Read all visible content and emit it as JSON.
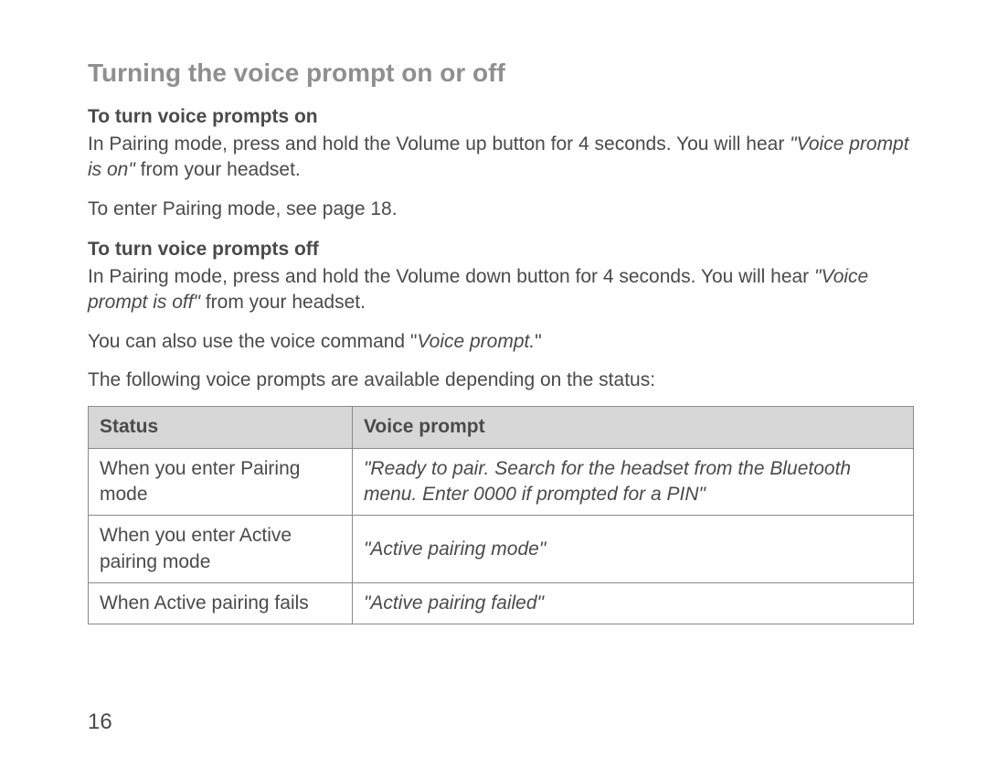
{
  "page_number": "16",
  "title": "Turning the voice prompt on or off",
  "on": {
    "heading": "To turn voice prompts on",
    "p1_pre": "In Pairing mode, press and hold the Volume up button for 4 seconds. You will hear ",
    "p1_quote": "\"Voice prompt is on\"",
    "p1_post": " from your headset.",
    "p2": "To enter Pairing mode, see page 18."
  },
  "off": {
    "heading": "To turn voice prompts off",
    "p1_pre": "In Pairing mode, press and hold the Volume down button for 4 seconds. You will hear ",
    "p1_quote": "\"Voice prompt is off\"",
    "p1_post": " from your headset.",
    "p2_pre": "You can also use the voice command \"",
    "p2_quote": "Voice prompt.",
    "p2_post": "\"",
    "p3": "The following voice prompts are available depending on the status:"
  },
  "table": {
    "headers": {
      "status": "Status",
      "prompt": "Voice prompt"
    },
    "rows": [
      {
        "status": "When you enter Pairing mode",
        "prompt": "\"Ready to pair. Search for the headset from the Bluetooth menu. Enter 0000 if prompted for a PIN\""
      },
      {
        "status": "When you enter Active pairing mode",
        "prompt": "\"Active pairing mode\""
      },
      {
        "status": "When Active pairing fails",
        "prompt": "\"Active pairing failed\""
      }
    ]
  }
}
